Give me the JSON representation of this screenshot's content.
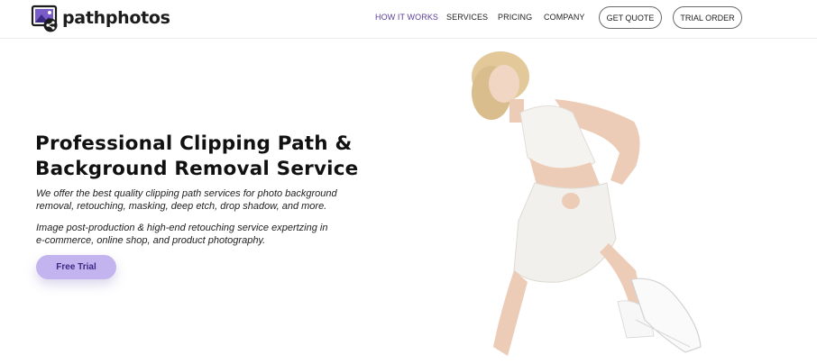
{
  "brand": {
    "name": "pathphotos"
  },
  "nav": {
    "links": [
      "HOW IT WORKS",
      "SERVICES",
      "PRICING",
      "COMPANY"
    ],
    "active_index": 0,
    "get_quote": "GET QUOTE",
    "trial_order": "TRIAL ORDER"
  },
  "hero": {
    "title_lines": [
      "Professional Clipping Path &",
      "Background Removal Service"
    ],
    "paragraph1_lines": [
      "We offer the best quality clipping path services for photo background",
      "removal, retouching, masking, deep etch, drop shadow, and more."
    ],
    "paragraph2_lines": [
      "Image post-production & high-end retouching service expertzing in",
      "e-commerce, online shop, and product photography."
    ],
    "cta_label": "Free Trial"
  },
  "colors": {
    "accent": "#5a3f9a",
    "cta_bg": "#c3b3ee",
    "cta_text": "#3d2a86"
  },
  "icons": {
    "logo": "photo-share-logo-icon"
  }
}
